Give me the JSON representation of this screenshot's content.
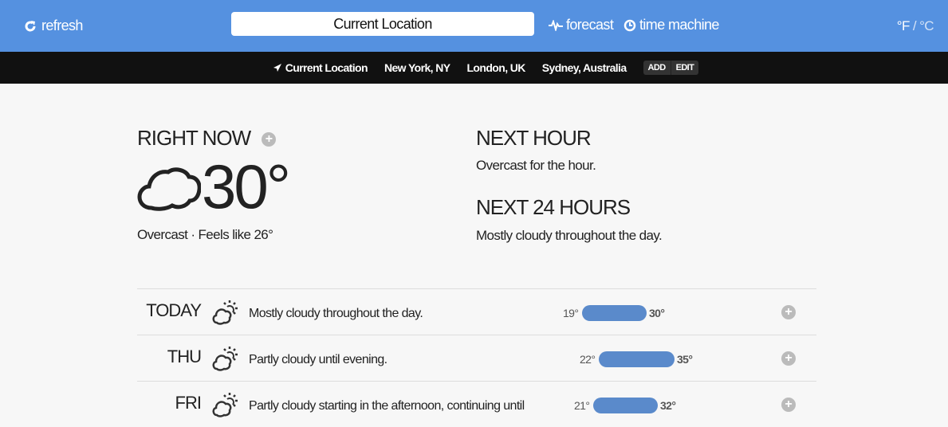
{
  "header": {
    "refresh": "refresh",
    "search_value": "Current Location",
    "forecast": "forecast",
    "time_machine": "time machine",
    "unit_f": "°F",
    "unit_sep": " / ",
    "unit_c": "°C"
  },
  "locations": {
    "items": [
      "Current Location",
      "New York, NY",
      "London, UK",
      "Sydney, Australia"
    ],
    "add": "ADD",
    "edit": "EDIT"
  },
  "now": {
    "heading": "RIGHT NOW",
    "temp": "30°",
    "summary": "Overcast · Feels like 26°"
  },
  "next_hour": {
    "heading": "NEXT HOUR",
    "text": "Overcast for the hour."
  },
  "next_24": {
    "heading": "NEXT 24 HOURS",
    "text": "Mostly cloudy throughout the day."
  },
  "days": [
    {
      "day": "TODAY",
      "summary": "Mostly cloudy throughout the day.",
      "low": 19,
      "high": 30,
      "low_label": "19°",
      "high_label": "30°"
    },
    {
      "day": "THU",
      "summary": "Partly cloudy until evening.",
      "low": 22,
      "high": 35,
      "low_label": "22°",
      "high_label": "35°"
    },
    {
      "day": "FRI",
      "summary": "Partly cloudy starting in the afternoon, continuing until",
      "low": 21,
      "high": 32,
      "low_label": "21°",
      "high_label": "32°"
    }
  ],
  "colors": {
    "header": "#5591e0",
    "bar": "#5a8acb"
  }
}
